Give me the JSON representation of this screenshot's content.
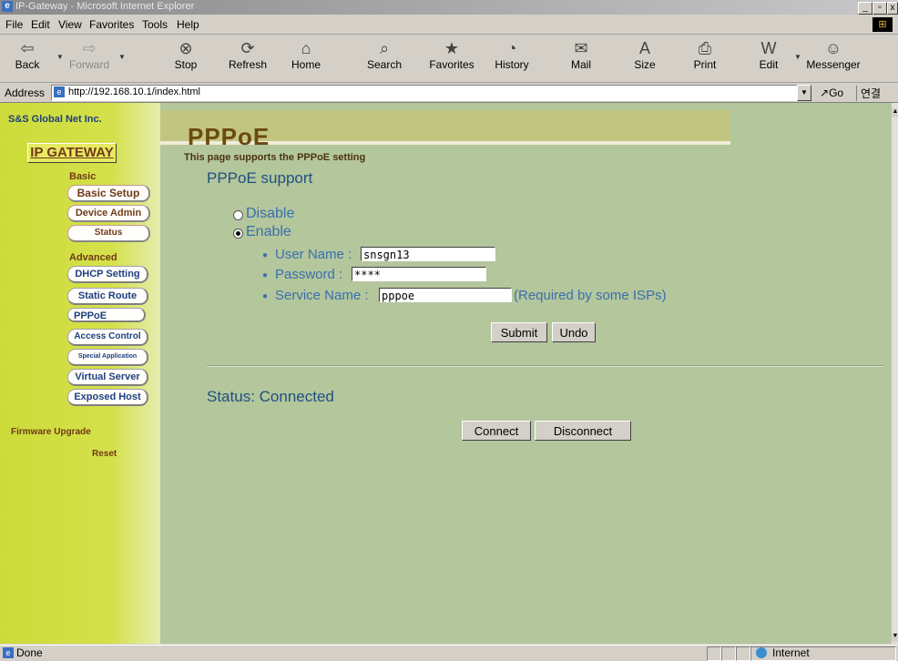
{
  "window": {
    "title": "IP-Gateway - Microsoft Internet Explorer",
    "controls": [
      "_",
      "̅",
      "X"
    ]
  },
  "menu": [
    "File",
    "Edit",
    "View",
    "Favorites",
    "Tools",
    "Help"
  ],
  "toolbar": {
    "back": "Back",
    "forward": "Forward",
    "stop": "Stop",
    "refresh": "Refresh",
    "home": "Home",
    "search": "Search",
    "favorites": "Favorites",
    "history": "History",
    "mail": "Mail",
    "size": "Size",
    "print": "Print",
    "edit": "Edit",
    "messenger": "Messenger"
  },
  "address": {
    "label": "Address",
    "url": "http://192.168.10.1/index.html",
    "go": "Go",
    "links": "연결"
  },
  "sidebar": {
    "company": "S&S Global Net Inc.",
    "product": "IP GATEWAY",
    "basic_label": "Basic",
    "basic_items": [
      "Basic Setup",
      "Device Admin",
      "Status"
    ],
    "advanced_label": "Advanced",
    "advanced_items": [
      "DHCP Setting",
      "Static Route",
      "PPPoE",
      "Access Control",
      "Special Application",
      "Virtual Server",
      "Exposed Host"
    ],
    "firmware": "Firmware Upgrade",
    "reset": "Reset"
  },
  "page": {
    "title": "PPPoE",
    "subtitle": "This page supports the PPPoE setting",
    "section": "PPPoE support",
    "disable_label": "Disable",
    "enable_label": "Enable",
    "selected": "Enable",
    "user_name_label": "User Name :",
    "user_name": "snsgn13",
    "password_label": "Password :",
    "password": "****",
    "service_name_label": "Service Name :",
    "service_name": "pppoe",
    "service_hint": "(Required by some ISPs)",
    "submit": "Submit",
    "undo": "Undo",
    "status": "Status: Connected",
    "connect": "Connect",
    "disconnect": "Disconnect"
  },
  "statusbar": {
    "text": "Done",
    "zone": "Internet"
  }
}
